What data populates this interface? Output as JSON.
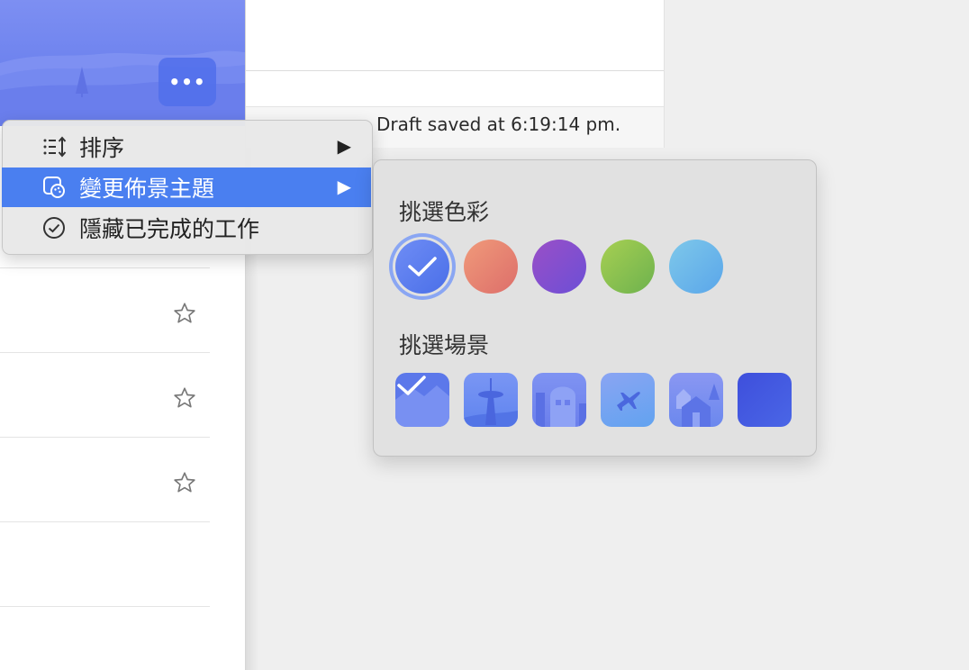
{
  "status": {
    "draft_saved": "Draft saved at 6:19:14 pm."
  },
  "header": {
    "more_label": "•••"
  },
  "context_menu": {
    "items": [
      {
        "label": "排序",
        "icon": "sort-icon",
        "submenu": true
      },
      {
        "label": "變更佈景主題",
        "icon": "theme-palette-icon",
        "submenu": true,
        "active": true
      },
      {
        "label": "隱藏已完成的工作",
        "icon": "check-circle-icon",
        "submenu": false
      }
    ],
    "arrow": "▶"
  },
  "theme_popover": {
    "color_title": "挑選色彩",
    "colors": [
      {
        "name": "blue",
        "from": "#6f8df5",
        "to": "#4a6fe8",
        "selected": true
      },
      {
        "name": "red",
        "from": "#f09a7a",
        "to": "#dd6e6a",
        "selected": false
      },
      {
        "name": "purple",
        "from": "#9a4fc7",
        "to": "#6c4fd6",
        "selected": false
      },
      {
        "name": "green",
        "from": "#a7cf52",
        "to": "#6db24e",
        "selected": false
      },
      {
        "name": "light-blue",
        "from": "#7ec8ea",
        "to": "#5aa6ea",
        "selected": false
      }
    ],
    "scene_title": "挑選場景",
    "scenes": [
      {
        "name": "mountains",
        "selected": true,
        "color": "#5c78ea"
      },
      {
        "name": "space-needle",
        "selected": false,
        "color": "#6e8ef2"
      },
      {
        "name": "city",
        "selected": false,
        "color": "#6f87ee"
      },
      {
        "name": "airplane",
        "selected": false,
        "color": "#79a8f2"
      },
      {
        "name": "town",
        "selected": false,
        "color": "#7a8ff0"
      },
      {
        "name": "solid",
        "selected": false,
        "color": "#4456e0"
      }
    ]
  },
  "task_rows": {
    "count": 3
  }
}
